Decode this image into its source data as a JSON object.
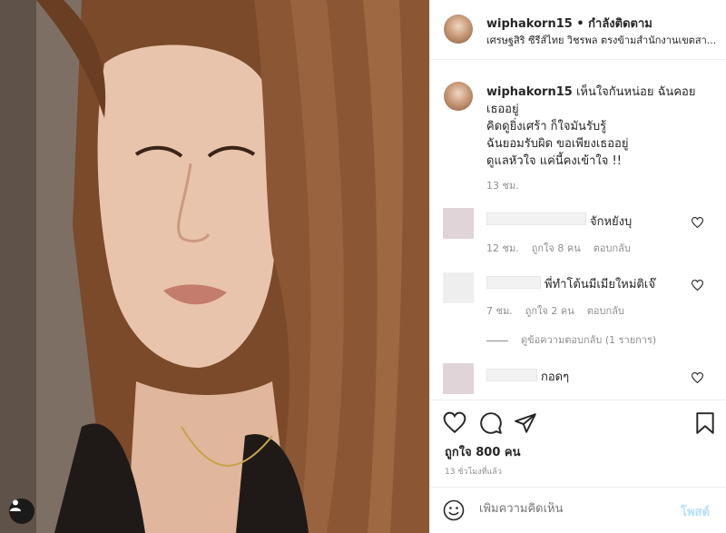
{
  "post": {
    "username": "wiphakorn15",
    "separator": "•",
    "follow_label": "กำลังติดตาม",
    "location": "เศรษฐสิริ ซีรีส์ไทย วิชรพล ตรงข้ามสำนักงานเขตสา...",
    "caption_lines": [
      "เห็นใจกันหน่อย ฉันคอย",
      "เธออยู่",
      "คิดดูยิ่งเศร้า ก็ใจมันรับรู้",
      "ฉันยอมรับผิด ขอเพียงเธออยู่",
      "ดูแลหัวใจ แค่นี้คงเข้าใจ !!"
    ],
    "caption_time": "13 ชม."
  },
  "comments": [
    {
      "text": "จักหยังบุ",
      "time": "12 ชม.",
      "likes": "ถูกใจ 8 คน",
      "reply": "ตอบกลับ"
    },
    {
      "text": "พี่ทำโต้นมีเมียใหม่ติเจ๊",
      "time": "7 ชม.",
      "likes": "ถูกใจ 2 คน",
      "reply": "ตอบกลับ"
    },
    {
      "text": "กอดๆ"
    }
  ],
  "view_replies": "ดูข้อความตอบกลับ (1 รายการ)",
  "likes_count": "ถูกใจ 800 คน",
  "time_ago": "13 ชั่วโมงที่แล้ว",
  "compose": {
    "placeholder": "เพิ่มความคิดเห็น",
    "post_label": "โพสต์"
  },
  "icons": {
    "heart": "heart-icon",
    "comment": "comment-icon",
    "share": "paper-plane-icon",
    "save": "bookmark-icon",
    "emoji": "smiley-icon",
    "user_tag": "user-icon"
  },
  "colors": {
    "post_button": "#b2dffc",
    "muted_text": "#8e8e8e",
    "border": "#efefef"
  }
}
